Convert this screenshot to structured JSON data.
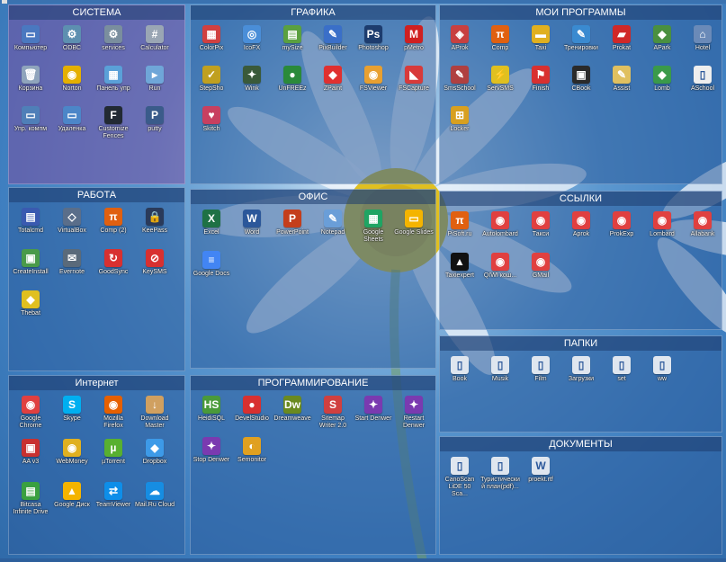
{
  "panels": {
    "sistema": {
      "title": "СИСТЕМА",
      "items": [
        {
          "label": "Компьютер",
          "icon": "computer-icon",
          "color": "#4a78c0",
          "glyph": "▭"
        },
        {
          "label": "ODBC",
          "icon": "odbc-icon",
          "color": "#5d8fb0",
          "glyph": "⚙"
        },
        {
          "label": "services",
          "icon": "services-icon",
          "color": "#7a8e9e",
          "glyph": "⚙"
        },
        {
          "label": "Calculator",
          "icon": "calculator-icon",
          "color": "#9aa6b4",
          "glyph": "#"
        },
        {
          "label": "Корзина",
          "icon": "recycle-bin-icon",
          "color": "#8fa4bc",
          "glyph": "🗑"
        },
        {
          "label": "Norton",
          "icon": "norton-icon",
          "color": "#e5b000",
          "glyph": "◉"
        },
        {
          "label": "Панель упр",
          "icon": "control-panel-icon",
          "color": "#5aa0d8",
          "glyph": "▦"
        },
        {
          "label": "Run",
          "icon": "run-icon",
          "color": "#6fa6d8",
          "glyph": "▸"
        },
        {
          "label": "Упр. компм",
          "icon": "computer-management-icon",
          "color": "#4f7fb8",
          "glyph": "▭"
        },
        {
          "label": "Удаленка",
          "icon": "remote-desktop-icon",
          "color": "#4c86c8",
          "glyph": "▭"
        },
        {
          "label": "Customize Fences",
          "icon": "fences-icon",
          "color": "#222a33",
          "glyph": "F"
        },
        {
          "label": "putty",
          "icon": "putty-icon",
          "color": "#3a5b8a",
          "glyph": "P"
        }
      ]
    },
    "grafika": {
      "title": "ГРАФИКА",
      "items": [
        {
          "label": "ColorPix",
          "icon": "colorpix-icon",
          "color": "#d04040",
          "glyph": "▦"
        },
        {
          "label": "IcoFX",
          "icon": "icofx-icon",
          "color": "#4a8ed8",
          "glyph": "◎"
        },
        {
          "label": "mySize",
          "icon": "mysize-icon",
          "color": "#5aa040",
          "glyph": "▤"
        },
        {
          "label": "PixBuilder",
          "icon": "pixbuilder-icon",
          "color": "#3a6fc8",
          "glyph": "✎"
        },
        {
          "label": "Photoshop",
          "icon": "photoshop-icon",
          "color": "#1d3c6e",
          "glyph": "Ps"
        },
        {
          "label": "pMetro",
          "icon": "pmetro-icon",
          "color": "#d02020",
          "glyph": "M"
        },
        {
          "label": "StepSho",
          "icon": "stepsho-icon",
          "color": "#c0a020",
          "glyph": "✓"
        },
        {
          "label": "Wink",
          "icon": "wink-icon",
          "color": "#3a5a3a",
          "glyph": "✦"
        },
        {
          "label": "UnFREEz",
          "icon": "unfreez-icon",
          "color": "#2a8a3a",
          "glyph": "●"
        },
        {
          "label": "ZPaint",
          "icon": "zpaint-icon",
          "color": "#e03030",
          "glyph": "◆"
        },
        {
          "label": "FSViewer",
          "icon": "fsviewer-icon",
          "color": "#e8a030",
          "glyph": "◉"
        },
        {
          "label": "FSCapture",
          "icon": "fscapture-icon",
          "color": "#d83a3a",
          "glyph": "◣"
        },
        {
          "label": "Skitch",
          "icon": "skitch-icon",
          "color": "#c84060",
          "glyph": "♥"
        }
      ]
    },
    "moi": {
      "title": "МОИ ПРОГРАММЫ",
      "items": [
        {
          "label": "AProk",
          "icon": "aprok-icon",
          "color": "#c84040",
          "glyph": "◈"
        },
        {
          "label": "Comp",
          "icon": "comp-icon",
          "color": "#e06010",
          "glyph": "π"
        },
        {
          "label": "Taxi",
          "icon": "taxi-icon",
          "color": "#e0b020",
          "glyph": "▬"
        },
        {
          "label": "Тренировки",
          "icon": "trainings-icon",
          "color": "#3a8ad0",
          "glyph": "✎"
        },
        {
          "label": "Prokat",
          "icon": "prokat-icon",
          "color": "#d02828",
          "glyph": "▰"
        },
        {
          "label": "APark",
          "icon": "apark-icon",
          "color": "#4a9040",
          "glyph": "◆"
        },
        {
          "label": "Hotel",
          "icon": "hotel-icon",
          "color": "#6a8ab8",
          "glyph": "⌂"
        },
        {
          "label": "SmsSchool",
          "icon": "smsschool-icon",
          "color": "#b04040",
          "glyph": "✎"
        },
        {
          "label": "ServSMS",
          "icon": "servsms-icon",
          "color": "#e0c020",
          "glyph": "⚡"
        },
        {
          "label": "Finish",
          "icon": "finish-icon",
          "color": "#d83030",
          "glyph": "⚑"
        },
        {
          "label": "CBook",
          "icon": "cbook-icon",
          "color": "#2a2a2a",
          "glyph": "▣"
        },
        {
          "label": "Assist",
          "icon": "assist-icon",
          "color": "#e0c060",
          "glyph": "✎"
        },
        {
          "label": "Lomb",
          "icon": "lomb-icon",
          "color": "#3a9a4a",
          "glyph": "◆"
        },
        {
          "label": "ASchool",
          "icon": "aschool-icon",
          "color": "#eeeeee",
          "glyph": "▯"
        },
        {
          "label": "Locker",
          "icon": "locker-icon",
          "color": "#d8a020",
          "glyph": "⊞"
        }
      ]
    },
    "rabota": {
      "title": "РАБОТА",
      "items": [
        {
          "label": "Totalcmd",
          "icon": "totalcmd-icon",
          "color": "#3a5ab0",
          "glyph": "▤"
        },
        {
          "label": "VirtualBox",
          "icon": "virtualbox-icon",
          "color": "#5a6e8a",
          "glyph": "◇"
        },
        {
          "label": "Comp (2)",
          "icon": "comp2-icon",
          "color": "#e06010",
          "glyph": "π"
        },
        {
          "label": "KeePass",
          "icon": "keepass-icon",
          "color": "#2a3a5a",
          "glyph": "🔒"
        },
        {
          "label": "CreateInstall",
          "icon": "createinstall-icon",
          "color": "#4a9a4a",
          "glyph": "▣"
        },
        {
          "label": "Evernote",
          "icon": "evernote-icon",
          "color": "#5a6a7a",
          "glyph": "✉"
        },
        {
          "label": "GoodSync",
          "icon": "goodsync-icon",
          "color": "#d83030",
          "glyph": "↻"
        },
        {
          "label": "KeySMS",
          "icon": "keysms-icon",
          "color": "#d83030",
          "glyph": "⊘"
        },
        {
          "label": "Thebat",
          "icon": "thebat-icon",
          "color": "#e0c020",
          "glyph": "◆"
        }
      ]
    },
    "ofis": {
      "title": "ОФИС",
      "items": [
        {
          "label": "Excel",
          "icon": "excel-icon",
          "color": "#1e7145",
          "glyph": "X"
        },
        {
          "label": "Word",
          "icon": "word-icon",
          "color": "#2b579a",
          "glyph": "W"
        },
        {
          "label": "PowerPoint",
          "icon": "powerpoint-icon",
          "color": "#c43e1c",
          "glyph": "P"
        },
        {
          "label": "Notepad",
          "icon": "notepad-icon",
          "color": "#6a9ed8",
          "glyph": "✎"
        },
        {
          "label": "Google Sheets",
          "icon": "google-sheets-icon",
          "color": "#1fa463",
          "glyph": "▦"
        },
        {
          "label": "Google Slides",
          "icon": "google-slides-icon",
          "color": "#f4b400",
          "glyph": "▭"
        },
        {
          "label": "Google Docs",
          "icon": "google-docs-icon",
          "color": "#4285f4",
          "glyph": "≡"
        }
      ]
    },
    "ssylki": {
      "title": "ССЫЛКИ",
      "items": [
        {
          "label": "PiSoft.ru",
          "icon": "pisoft-icon",
          "color": "#e06010",
          "glyph": "π"
        },
        {
          "label": "Autolombard",
          "icon": "chrome-icon",
          "color": "#e04040",
          "glyph": "◉"
        },
        {
          "label": "Такси",
          "icon": "chrome-icon",
          "color": "#e04040",
          "glyph": "◉"
        },
        {
          "label": "Aprok",
          "icon": "chrome-icon",
          "color": "#e04040",
          "glyph": "◉"
        },
        {
          "label": "ProkExp",
          "icon": "chrome-icon",
          "color": "#e04040",
          "glyph": "◉"
        },
        {
          "label": "Lombard",
          "icon": "chrome-icon",
          "color": "#e04040",
          "glyph": "◉"
        },
        {
          "label": "Allabank",
          "icon": "chrome-icon",
          "color": "#e04040",
          "glyph": "◉"
        },
        {
          "label": "Taxiexpert",
          "icon": "taxiexpert-icon",
          "color": "#111111",
          "glyph": "▲"
        },
        {
          "label": "QIWI кош...",
          "icon": "chrome-icon",
          "color": "#e04040",
          "glyph": "◉"
        },
        {
          "label": "GMail",
          "icon": "chrome-icon",
          "color": "#e04040",
          "glyph": "◉"
        }
      ]
    },
    "papki": {
      "title": "ПАПКИ",
      "items": [
        {
          "label": "Book",
          "icon": "folder-shortcut-icon",
          "color": "#dfe6ef",
          "glyph": "▯"
        },
        {
          "label": "Musik",
          "icon": "folder-shortcut-icon",
          "color": "#dfe6ef",
          "glyph": "▯"
        },
        {
          "label": "Film",
          "icon": "folder-shortcut-icon",
          "color": "#dfe6ef",
          "glyph": "▯"
        },
        {
          "label": "Загрузки",
          "icon": "folder-shortcut-icon",
          "color": "#dfe6ef",
          "glyph": "▯"
        },
        {
          "label": "set",
          "icon": "folder-shortcut-icon",
          "color": "#dfe6ef",
          "glyph": "▯"
        },
        {
          "label": "ww",
          "icon": "folder-shortcut-icon",
          "color": "#dfe6ef",
          "glyph": "▯"
        }
      ]
    },
    "internet": {
      "title": "Интернет",
      "items": [
        {
          "label": "Google Chrome",
          "icon": "chrome-icon",
          "color": "#e04040",
          "glyph": "◉"
        },
        {
          "label": "Skype",
          "icon": "skype-icon",
          "color": "#00aff0",
          "glyph": "S"
        },
        {
          "label": "Mozilla Firefox",
          "icon": "firefox-icon",
          "color": "#e66000",
          "glyph": "◉"
        },
        {
          "label": "Download Master",
          "icon": "download-master-icon",
          "color": "#d0a060",
          "glyph": "↓"
        },
        {
          "label": "AA v3",
          "icon": "aa-icon",
          "color": "#c83030",
          "glyph": "▣"
        },
        {
          "label": "WebMoney",
          "icon": "webmoney-icon",
          "color": "#e0b020",
          "glyph": "◉"
        },
        {
          "label": "µTorrent",
          "icon": "utorrent-icon",
          "color": "#58b030",
          "glyph": "µ"
        },
        {
          "label": "Dropbox",
          "icon": "dropbox-icon",
          "color": "#3d9ae8",
          "glyph": "◆"
        },
        {
          "label": "Bitcasa Infinite Drive",
          "icon": "bitcasa-icon",
          "color": "#3aa040",
          "glyph": "▤"
        },
        {
          "label": "Google Диск",
          "icon": "google-drive-icon",
          "color": "#f4b400",
          "glyph": "▲"
        },
        {
          "label": "TeamViewer",
          "icon": "teamviewer-icon",
          "color": "#0e8ee9",
          "glyph": "⇄"
        },
        {
          "label": "Mail.Ru Cloud",
          "icon": "mailru-cloud-icon",
          "color": "#168de2",
          "glyph": "☁"
        }
      ]
    },
    "programmirovanie": {
      "title": "ПРОГРАММИРОВАНИЕ",
      "items": [
        {
          "label": "HeidiSQL",
          "icon": "heidisql-icon",
          "color": "#4a9a3a",
          "glyph": "HS"
        },
        {
          "label": "DevelStudio",
          "icon": "develstudio-icon",
          "color": "#d83030",
          "glyph": "●"
        },
        {
          "label": "Dreamweave",
          "icon": "dreamweaver-icon",
          "color": "#6a8a20",
          "glyph": "Dw"
        },
        {
          "label": "Sitemap Writer 2.0",
          "icon": "sitemap-writer-icon",
          "color": "#d04040",
          "glyph": "S"
        },
        {
          "label": "Start Denwer",
          "icon": "start-denwer-icon",
          "color": "#7a3ab0",
          "glyph": "✦"
        },
        {
          "label": "Restart Denwer",
          "icon": "restart-denwer-icon",
          "color": "#7a3ab0",
          "glyph": "✦"
        },
        {
          "label": "Stop Denwer",
          "icon": "stop-denwer-icon",
          "color": "#7a3ab0",
          "glyph": "✦"
        },
        {
          "label": "Semonitor",
          "icon": "semonitor-icon",
          "color": "#e0a020",
          "glyph": "◐"
        }
      ]
    },
    "dokumenty": {
      "title": "ДОКУМЕНТЫ",
      "items": [
        {
          "label": "CanoScan LiDE 50 Sca...",
          "icon": "shortcut-icon",
          "color": "#dfe6ef",
          "glyph": "▯"
        },
        {
          "label": "Туристический план(pdf)...",
          "icon": "shortcut-icon",
          "color": "#dfe6ef",
          "glyph": "▯"
        },
        {
          "label": "proekt.rtf",
          "icon": "word-doc-icon",
          "color": "#dfe6ef",
          "glyph": "W"
        }
      ]
    }
  }
}
